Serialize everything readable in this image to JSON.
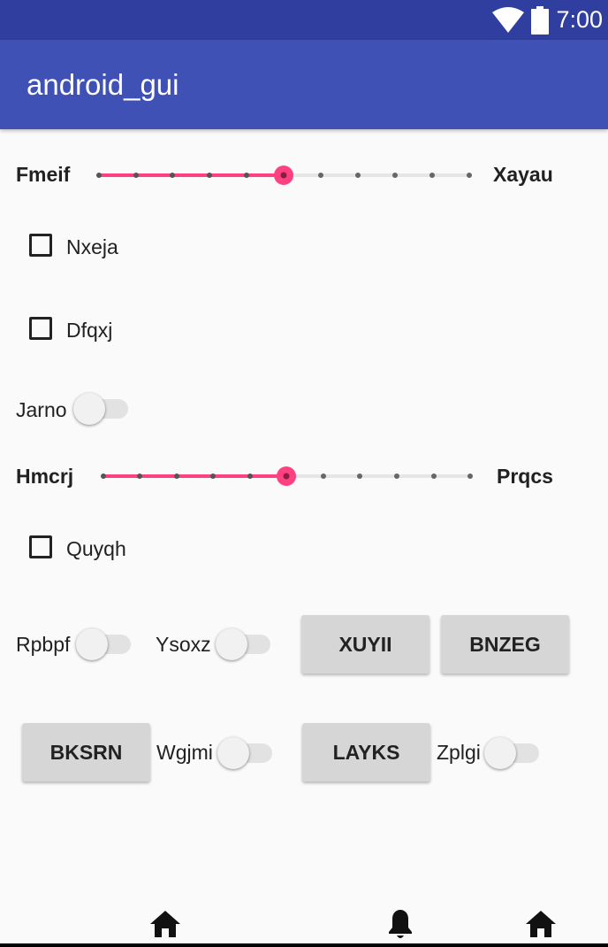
{
  "status_bar": {
    "time": "7:00",
    "wifi_icon": "wifi-icon",
    "battery_icon": "battery-icon"
  },
  "app_bar": {
    "title": "android_gui"
  },
  "slider1": {
    "label_start": "Fmeif",
    "label_end": "Xayau",
    "position_index": 5,
    "steps": 10
  },
  "checkbox1": {
    "label": "Nxeja",
    "checked": false
  },
  "checkbox2": {
    "label": "Dfqxj",
    "checked": false
  },
  "switch1": {
    "label": "Jarno",
    "on": false
  },
  "slider2": {
    "label_start": "Hmcrj",
    "label_end": "Prqcs",
    "position_index": 5,
    "steps": 10
  },
  "checkbox3": {
    "label": "Quyqh",
    "checked": false
  },
  "switch2": {
    "label": "Rpbpf",
    "on": false
  },
  "switch3": {
    "label": "Ysoxz",
    "on": false
  },
  "button1": {
    "label": "XUYII"
  },
  "button2": {
    "label": "BNZEG"
  },
  "button3": {
    "label": "BKSRN"
  },
  "switch4": {
    "label": "Wgjmi",
    "on": false
  },
  "button4": {
    "label": "LAYKS"
  },
  "switch5": {
    "label": "Zplgi",
    "on": false
  },
  "bottom_nav": {
    "icons": [
      "home-icon",
      "bell-icon",
      "home-icon"
    ]
  },
  "colors": {
    "primary": "#3f51b5",
    "primary_dark": "#303f9f",
    "accent": "#ff4081"
  }
}
